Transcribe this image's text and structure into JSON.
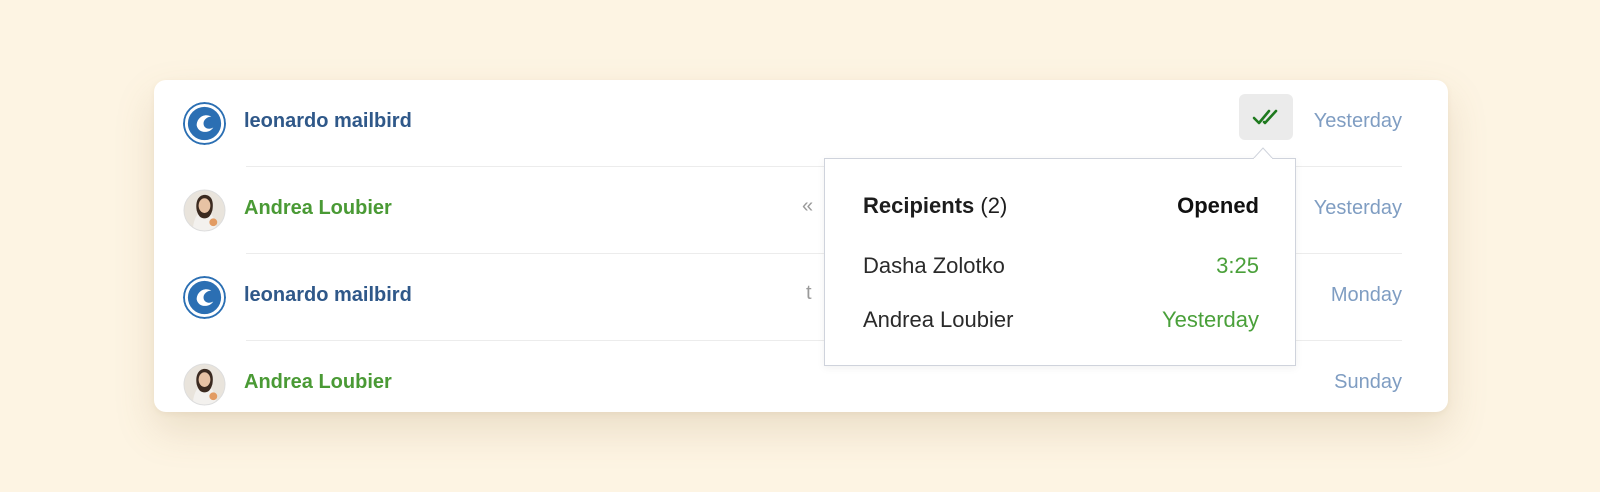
{
  "messages": [
    {
      "sender": "leonardo mailbird",
      "avatar": "mailbird-logo",
      "date": "Yesterday",
      "name_color": "#2f5889"
    },
    {
      "sender": "Andrea Loubier",
      "avatar": "person-photo",
      "date": "Yesterday",
      "name_color": "#4a9a35"
    },
    {
      "sender": "leonardo mailbird",
      "avatar": "mailbird-logo",
      "date": "Monday",
      "name_color": "#2f5889"
    },
    {
      "sender": "Andrea Loubier",
      "avatar": "person-photo",
      "date": "Sunday",
      "name_color": "#4a9a35"
    }
  ],
  "tracker": {
    "icon": "double-check-icon",
    "icon_color": "#1f7a1f"
  },
  "popup": {
    "recipients_label": "Recipients",
    "recipients_count": "(2)",
    "opened_label": "Opened",
    "recipients": [
      {
        "name": "Dasha Zolotko",
        "opened": "3:25"
      },
      {
        "name": "Andrea Loubier",
        "opened": "Yesterday"
      }
    ]
  },
  "colors": {
    "background": "#fdf4e3",
    "date_text": "#7f9dc2",
    "opened_time": "#4aa03a"
  }
}
